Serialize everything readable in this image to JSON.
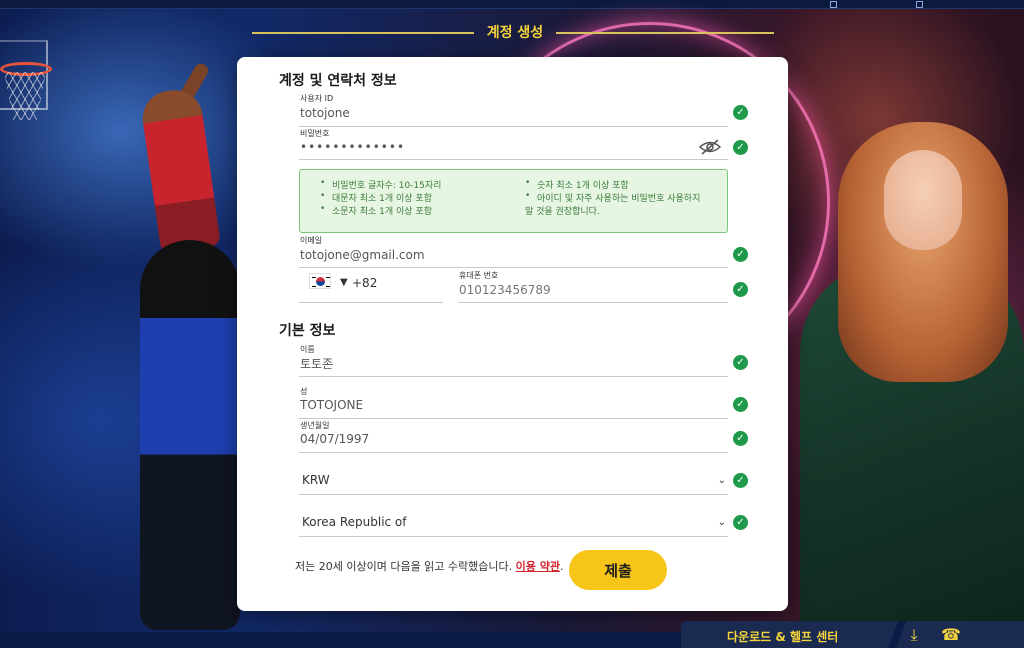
{
  "page": {
    "heading": "계정 생성",
    "accent_color": "#f4d23c",
    "check_color": "#1e9a4a"
  },
  "account_section": {
    "title": "계정 및 연락처 정보",
    "username": {
      "label": "사용자 ID",
      "value": "totojone"
    },
    "password": {
      "label": "비밀번호",
      "value": "•••••••••••••"
    },
    "password_rules": [
      "비밀번호 글자수: 10-15자리",
      "대문자 최소 1개 이상 포함",
      "소문자 최소 1개 이상 포함",
      "숫자 최소 1개 이상 포함",
      "아이디 및 자주 사용하는 비밀번호 사용하지",
      "말 것을 권장합니다."
    ],
    "email": {
      "label": "이메일",
      "value": "totojone@gmail.com"
    },
    "phone": {
      "country_code": "+82",
      "label": "휴대폰 번호",
      "value": "010123456789",
      "flag_icon": "korea-flag-icon"
    }
  },
  "basic_section": {
    "title": "기본 정보",
    "first_name": {
      "label": "이름",
      "value": "토토존"
    },
    "last_name": {
      "label": "성",
      "value": "TOTOJONE"
    },
    "birthdate": {
      "label": "생년월일",
      "value": "04/07/1997"
    },
    "currency": {
      "value": "KRW"
    },
    "country": {
      "value": "Korea Republic of"
    }
  },
  "footer": {
    "terms_text": "저는 20세 이상이며 다음을 읽고 수락했습니다. ",
    "terms_link": "이용 약관",
    "terms_end": ".",
    "submit_label": "제출"
  },
  "bottom_panel": {
    "label": "다운로드 & 헬프 센터",
    "icons": [
      "download-icon",
      "phone-support-icon"
    ]
  }
}
